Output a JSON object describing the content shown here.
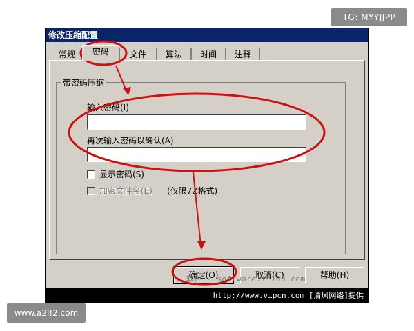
{
  "watermarks": {
    "top_right": "TG: MYYJJPP",
    "bottom_left": "www.a2l!2.com"
  },
  "dialog": {
    "title": "修改压缩配置",
    "tabs": [
      {
        "label": "常规",
        "active": false
      },
      {
        "label": "密码",
        "active": true
      },
      {
        "label": "文件",
        "active": false
      },
      {
        "label": "算法",
        "active": false
      },
      {
        "label": "时间",
        "active": false
      },
      {
        "label": "注释",
        "active": false
      }
    ],
    "group_title": "带密码压缩",
    "password_label": "输入密码(I)",
    "password_value": "",
    "confirm_label": "再次输入密码以确认(A)",
    "confirm_value": "",
    "show_password_label": "显示密码(S)",
    "encrypt_filenames_label": "加密文件名(E)",
    "encrypt_note": "(仅限7Z格式)",
    "buttons": {
      "ok": "确定(O)",
      "cancel": "取消(C)",
      "help": "帮助(H)"
    }
  },
  "footer_text": "http://www.vipcn.com [清风网络]提供",
  "overlay_text": "软件 - software.it168.com",
  "colors": {
    "titlebar": "#0a246a",
    "dialog_bg": "#d4d0c8",
    "annotation_red": "#d01010"
  }
}
